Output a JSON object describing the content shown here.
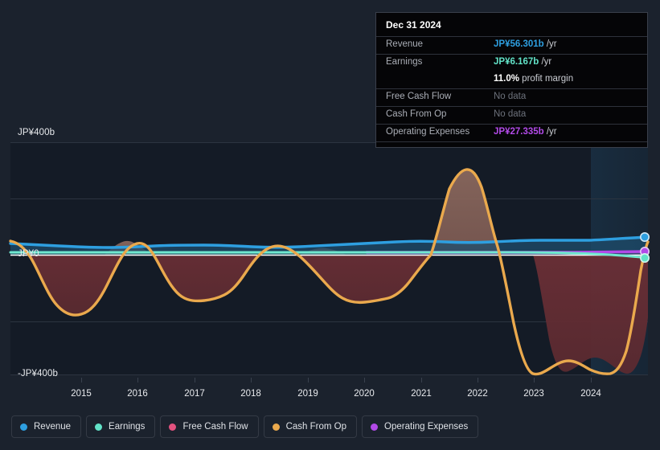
{
  "chart_data": {
    "type": "area",
    "title": "",
    "xlabel": "",
    "ylabel": "",
    "currency": "JP¥",
    "ylim": [
      -400,
      400
    ],
    "y_ticks": [
      {
        "value": 400,
        "label": "JP¥400b"
      },
      {
        "value": 0,
        "label": "JP¥0"
      },
      {
        "value": -400,
        "label": "-JP¥400b"
      }
    ],
    "gridlines": [
      400,
      200,
      0,
      -200,
      -400
    ],
    "x_ticks": [
      "2015",
      "2016",
      "2017",
      "2018",
      "2019",
      "2020",
      "2021",
      "2022",
      "2023",
      "2024"
    ],
    "xlim": [
      "2014.5",
      "2025.3"
    ],
    "legend_position": "bottom",
    "forecast_region_start": "2024.1",
    "series": [
      {
        "name": "Revenue",
        "color": "#2e9fe0",
        "x": [
          2014.5,
          2015,
          2015.5,
          2016,
          2016.5,
          2017,
          2017.5,
          2018,
          2018.5,
          2019,
          2019.5,
          2020,
          2020.5,
          2021,
          2021.5,
          2022,
          2022.5,
          2023,
          2023.5,
          2024,
          2024.5,
          2025.3
        ],
        "values": [
          48,
          47,
          46,
          44,
          43,
          45,
          46,
          46,
          45,
          44,
          44,
          45,
          46,
          47,
          49,
          51,
          52,
          53,
          53,
          54,
          56,
          56.301
        ]
      },
      {
        "name": "Earnings",
        "color": "#62e3c8",
        "x": [
          2014.5,
          2015,
          2016,
          2017,
          2018,
          2019,
          2020,
          2021,
          2022,
          2023,
          2024,
          2025.3
        ],
        "values": [
          10,
          10,
          9,
          9,
          9,
          9,
          9,
          9,
          9,
          9,
          8,
          6.167
        ]
      },
      {
        "name": "Free Cash Flow",
        "color": "#e2527f",
        "x": [],
        "values": [],
        "note": "No data"
      },
      {
        "name": "Cash From Op",
        "color": "#eaa94d",
        "x": [
          2014.5,
          2014.8,
          2015.2,
          2015.6,
          2016.0,
          2016.3,
          2016.6,
          2017.0,
          2017.3,
          2017.7,
          2018.0,
          2018.4,
          2018.8,
          2019.2,
          2019.6,
          2020.0,
          2020.4,
          2020.8,
          2021.2,
          2021.5,
          2021.8,
          2022.1,
          2022.35,
          2022.6,
          2023.0,
          2023.4,
          2023.8,
          2024.1,
          2024.5,
          2024.8
        ],
        "values": [
          20,
          -20,
          -130,
          -150,
          -120,
          -30,
          55,
          30,
          -40,
          -110,
          -110,
          -75,
          10,
          30,
          10,
          -40,
          -120,
          -120,
          -50,
          120,
          300,
          270,
          0,
          -330,
          -420,
          -380,
          -400,
          -430,
          -300,
          0
        ]
      },
      {
        "name": "Operating Expenses",
        "color": "#b24ae8",
        "x": [
          2020.0,
          2021,
          2022,
          2023,
          2024,
          2025.3
        ],
        "values": [
          6,
          6,
          6,
          6,
          6,
          27.335
        ]
      }
    ],
    "endpoints": [
      {
        "series": "Revenue",
        "color": "#2e9fe0",
        "value": 56.301
      },
      {
        "series": "Operating Expenses",
        "color": "#b24ae8",
        "value": 27.335
      },
      {
        "series": "Earnings",
        "color": "#62e3c8",
        "value": 6.167
      }
    ]
  },
  "tooltip": {
    "date": "Dec 31 2024",
    "rows": [
      {
        "label": "Revenue",
        "value": "JP¥56.301b",
        "suffix": " /yr",
        "color": "#2e9fe0",
        "no_data": false
      },
      {
        "label": "Earnings",
        "value": "JP¥6.167b",
        "suffix": " /yr",
        "color": "#62e3c8",
        "no_data": false
      },
      {
        "label": "",
        "value": "11.0%",
        "suffix": " profit margin",
        "color": "#ffffff",
        "no_data": false,
        "is_margin": true
      },
      {
        "label": "Free Cash Flow",
        "value": "No data",
        "suffix": "",
        "color": "#6d727c",
        "no_data": true
      },
      {
        "label": "Cash From Op",
        "value": "No data",
        "suffix": "",
        "color": "#6d727c",
        "no_data": true
      },
      {
        "label": "Operating Expenses",
        "value": "JP¥27.335b",
        "suffix": " /yr",
        "color": "#b24ae8",
        "no_data": false
      }
    ]
  },
  "legend": {
    "items": [
      {
        "label": "Revenue",
        "color": "#2e9fe0"
      },
      {
        "label": "Earnings",
        "color": "#62e3c8"
      },
      {
        "label": "Free Cash Flow",
        "color": "#e2527f"
      },
      {
        "label": "Cash From Op",
        "color": "#eaa94d"
      },
      {
        "label": "Operating Expenses",
        "color": "#b24ae8"
      }
    ]
  },
  "colors": {
    "background": "#1b222d",
    "plot_background": "#141b26",
    "gridline": "#2c3440",
    "zero_axis": "#ffffff",
    "negative_fill": "#5d2b30",
    "positive_fill": "#8c6a5e"
  }
}
